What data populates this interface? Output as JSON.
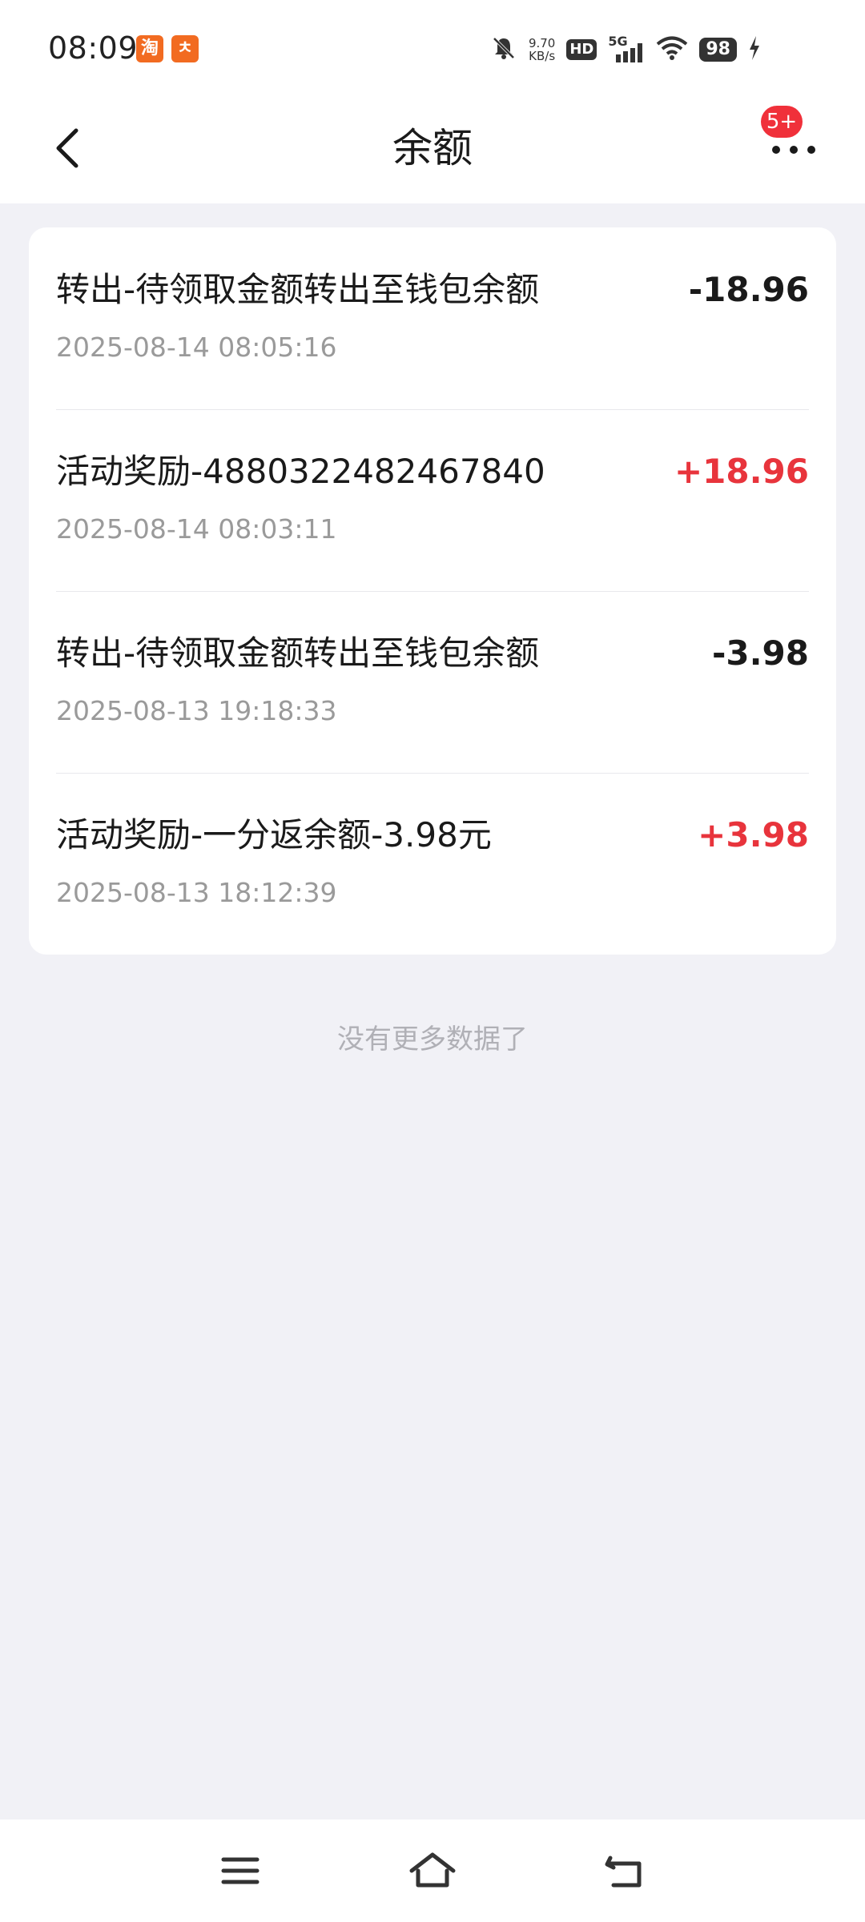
{
  "status_bar": {
    "time": "08:09",
    "notif_icons": [
      {
        "name": "taobao-app-icon",
        "glyph": "淘",
        "color": "#f26b21"
      },
      {
        "name": "running-person-app-icon",
        "glyph": "ㅊ",
        "color": "#f26b21"
      }
    ],
    "net_speed_value": "9.70",
    "net_speed_unit": "KB/s",
    "hd_label": "HD",
    "network_label": "5G",
    "battery_level": "98"
  },
  "header": {
    "title": "余额",
    "more_badge": "5+"
  },
  "transactions": [
    {
      "title": "转出-待领取金额转出至钱包余额",
      "time": "2025-08-14 08:05:16",
      "amount": "-18.96",
      "type": "negative"
    },
    {
      "title": "活动奖励-4880322482467840",
      "time": "2025-08-14 08:03:11",
      "amount": "+18.96",
      "type": "positive"
    },
    {
      "title": "转出-待领取金额转出至钱包余额",
      "time": "2025-08-13 19:18:33",
      "amount": "-3.98",
      "type": "negative"
    },
    {
      "title": "活动奖励-一分返余额-3.98元",
      "time": "2025-08-13 18:12:39",
      "amount": "+3.98",
      "type": "positive"
    }
  ],
  "footer_text": "没有更多数据了",
  "colors": {
    "positive": "#e8343c",
    "negative": "#1a1a1a",
    "badge": "#f0303a",
    "background": "#f1f1f6"
  }
}
